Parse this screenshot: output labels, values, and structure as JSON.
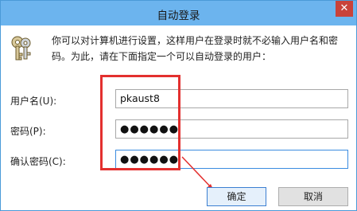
{
  "window": {
    "title": "自动登录",
    "close_glyph": "✕"
  },
  "description": {
    "line1": "你可以对计算机进行设置，这样用户在登录时就不必输入用户名和密",
    "line2": "码。为此，请在下面指定一个可以自动登录的用户："
  },
  "fields": {
    "username_label": "用户名(U):",
    "username_value": "pkaust8",
    "password_label": "密码(P):",
    "password_value": "●●●●●●",
    "confirm_label": "确认密码(C):",
    "confirm_value": "●●●●●●"
  },
  "buttons": {
    "ok_label": "确定",
    "cancel_label": "取消"
  },
  "colors": {
    "titlebar": "#6cb4ee",
    "close": "#c9423a",
    "annotation": "#e3302f",
    "focus_border": "#3b8ce0"
  },
  "icons": {
    "dialog_icon": "key-icon",
    "close": "close-icon"
  }
}
